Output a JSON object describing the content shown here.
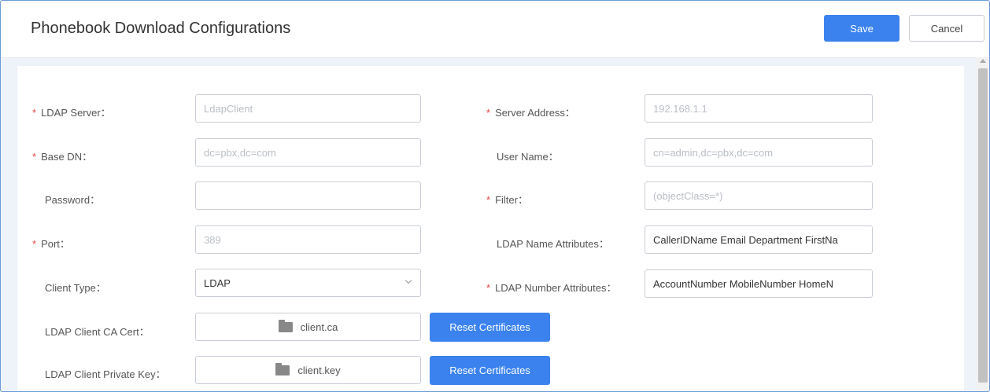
{
  "header": {
    "title": "Phonebook Download Configurations",
    "save_label": "Save",
    "cancel_label": "Cancel"
  },
  "form": {
    "ldap_server": {
      "label": "LDAP Server：",
      "placeholder": "LdapClient",
      "value": ""
    },
    "server_address": {
      "label": "Server Address：",
      "placeholder": "192.168.1.1",
      "value": ""
    },
    "base_dn": {
      "label": "Base DN：",
      "placeholder": "dc=pbx,dc=com",
      "value": ""
    },
    "user_name": {
      "label": "User Name：",
      "placeholder": "cn=admin,dc=pbx,dc=com",
      "value": ""
    },
    "password": {
      "label": "Password：",
      "value": ""
    },
    "filter": {
      "label": "Filter：",
      "placeholder": "(objectClass=*)",
      "value": ""
    },
    "port": {
      "label": "Port：",
      "placeholder": "389",
      "value": ""
    },
    "ldap_name_attributes": {
      "label": "LDAP Name Attributes：",
      "value": "CallerIDName Email Department FirstNa"
    },
    "client_type": {
      "label": "Client Type：",
      "value": "LDAP"
    },
    "ldap_number_attributes": {
      "label": "LDAP Number Attributes：",
      "value": "AccountNumber MobileNumber HomeN"
    },
    "ca_cert": {
      "label": "LDAP Client CA Cert：",
      "file": "client.ca",
      "button": "Reset Certificates"
    },
    "private_key": {
      "label": "LDAP Client Private Key：",
      "file": "client.key",
      "button": "Reset Certificates"
    }
  },
  "colors": {
    "primary": "#3b82ee",
    "required": "#e54545",
    "frame_border": "#6a9bd8"
  }
}
